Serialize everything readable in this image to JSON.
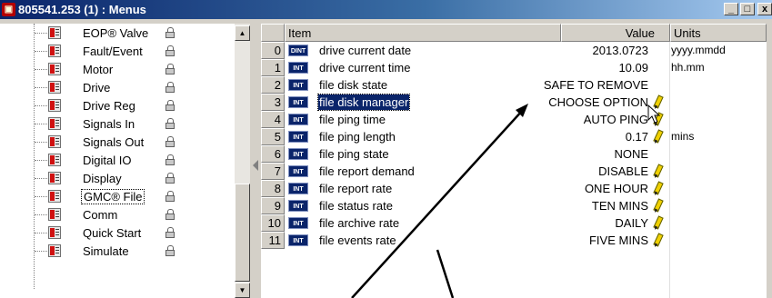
{
  "window": {
    "title": "805541.253 (1) : Menus",
    "app_icon": "app-icon",
    "controls": {
      "minimize": "_",
      "maximize": "□",
      "close": "x"
    }
  },
  "tree": {
    "items": [
      {
        "label": "EOP® Valve",
        "icon": "menu-node-icon",
        "lock_icon": "lock-icon"
      },
      {
        "label": "Fault/Event",
        "icon": "menu-node-icon",
        "lock_icon": "lock-icon"
      },
      {
        "label": "Motor",
        "icon": "menu-node-icon",
        "lock_icon": "lock-icon"
      },
      {
        "label": "Drive",
        "icon": "menu-node-icon",
        "lock_icon": "lock-icon"
      },
      {
        "label": "Drive Reg",
        "icon": "menu-node-icon",
        "lock_icon": "lock-icon"
      },
      {
        "label": "Signals In",
        "icon": "menu-node-icon",
        "lock_icon": "lock-icon"
      },
      {
        "label": "Signals Out",
        "icon": "menu-node-icon",
        "lock_icon": "lock-icon"
      },
      {
        "label": "Digital IO",
        "icon": "menu-node-icon",
        "lock_icon": "lock-icon"
      },
      {
        "label": "Display",
        "icon": "menu-node-icon",
        "lock_icon": "lock-icon"
      },
      {
        "label": "GMC® File",
        "icon": "menu-node-icon",
        "lock_icon": "lock-icon",
        "selected": true
      },
      {
        "label": "Comm",
        "icon": "menu-node-icon",
        "lock_icon": "lock-icon"
      },
      {
        "label": "Quick Start",
        "icon": "menu-node-icon",
        "lock_icon": "lock-icon"
      },
      {
        "label": "Simulate",
        "icon": "menu-node-icon",
        "lock_icon": "lock-icon"
      }
    ]
  },
  "grid": {
    "headers": {
      "item": "Item",
      "value": "Value",
      "units": "Units"
    },
    "rows": [
      {
        "num": "0",
        "type": "DINT",
        "name": "drive current date",
        "value": "2013.0723",
        "units": "yyyy.mmdd",
        "editable": false
      },
      {
        "num": "1",
        "type": "INT",
        "name": "drive current time",
        "value": "10.09",
        "units": "hh.mm",
        "editable": false
      },
      {
        "num": "2",
        "type": "INT",
        "name": "file disk state",
        "value": "SAFE TO REMOVE",
        "units": "",
        "editable": false
      },
      {
        "num": "3",
        "type": "INT",
        "name": "file disk manager",
        "value": "CHOOSE OPTION",
        "units": "",
        "editable": true,
        "selected": true
      },
      {
        "num": "4",
        "type": "INT",
        "name": "file ping time",
        "value": "AUTO PING",
        "units": "",
        "editable": true
      },
      {
        "num": "5",
        "type": "INT",
        "name": "file ping length",
        "value": "0.17",
        "units": "mins",
        "editable": true
      },
      {
        "num": "6",
        "type": "INT",
        "name": "file ping state",
        "value": "NONE",
        "units": "",
        "editable": false
      },
      {
        "num": "7",
        "type": "INT",
        "name": "file report demand",
        "value": "DISABLE",
        "units": "",
        "editable": true
      },
      {
        "num": "8",
        "type": "INT",
        "name": "file report rate",
        "value": "ONE HOUR",
        "units": "",
        "editable": true
      },
      {
        "num": "9",
        "type": "INT",
        "name": "file status rate",
        "value": "TEN MINS",
        "units": "",
        "editable": true
      },
      {
        "num": "10",
        "type": "INT",
        "name": "file archive rate",
        "value": "DAILY",
        "units": "",
        "editable": true
      },
      {
        "num": "11",
        "type": "INT",
        "name": "file events rate",
        "value": "FIVE MINS",
        "units": "",
        "editable": true
      }
    ],
    "edit_icon": "pencil-icon"
  },
  "colors": {
    "title_bar": "#0a246a",
    "selection": "#0a246a",
    "node_icon_red": "#d01010",
    "pencil_yellow": "#f0d000",
    "panel": "#d4d0c8"
  },
  "icons": {
    "scroll_up": "▲",
    "scroll_down": "▼"
  }
}
